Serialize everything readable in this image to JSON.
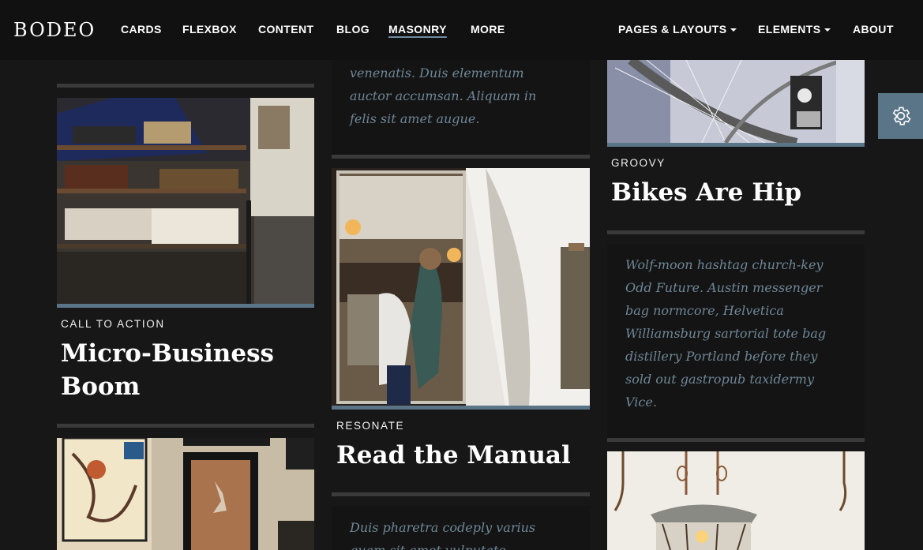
{
  "nav": {
    "logo": "BODEO",
    "links": [
      {
        "label": "CARDS"
      },
      {
        "label": "FLEXBOX"
      },
      {
        "label": "CONTENT"
      },
      {
        "label": "BLOG"
      },
      {
        "label": "MASONRY"
      },
      {
        "label": "MORE"
      }
    ],
    "right_links": [
      {
        "label": "PAGES & LAYOUTS"
      },
      {
        "label": "ELEMENTS"
      },
      {
        "label": "ABOUT"
      }
    ]
  },
  "col1": {
    "card1": {
      "category": "CALL TO ACTION",
      "title_line1": "Micro-Business",
      "title_line2": "Boom"
    }
  },
  "col2": {
    "text1": [
      "venenatis. Duis elementum",
      "auctor accumsan. Aliquam in",
      "felis sit amet augue."
    ],
    "card1": {
      "category": "RESONATE",
      "title": "Read the Manual"
    },
    "text2": [
      "Duis pharetra codeply varius",
      "quam sit amet vulputate."
    ]
  },
  "col3": {
    "card1": {
      "category": "GROOVY",
      "title": "Bikes Are Hip"
    },
    "text1": [
      "Wolf-moon hashtag church-key",
      "Odd Future. Austin messenger",
      "bag normcore, Helvetica",
      "Williamsburg sartorial tote bag",
      "distillery Portland before they",
      "sold out gastropub taxidermy",
      "Vice."
    ]
  },
  "settings": {
    "icon": "gear-icon"
  },
  "colors": {
    "accent": "#5a7488",
    "background": "#171717",
    "italic_text": "#6f8797"
  }
}
